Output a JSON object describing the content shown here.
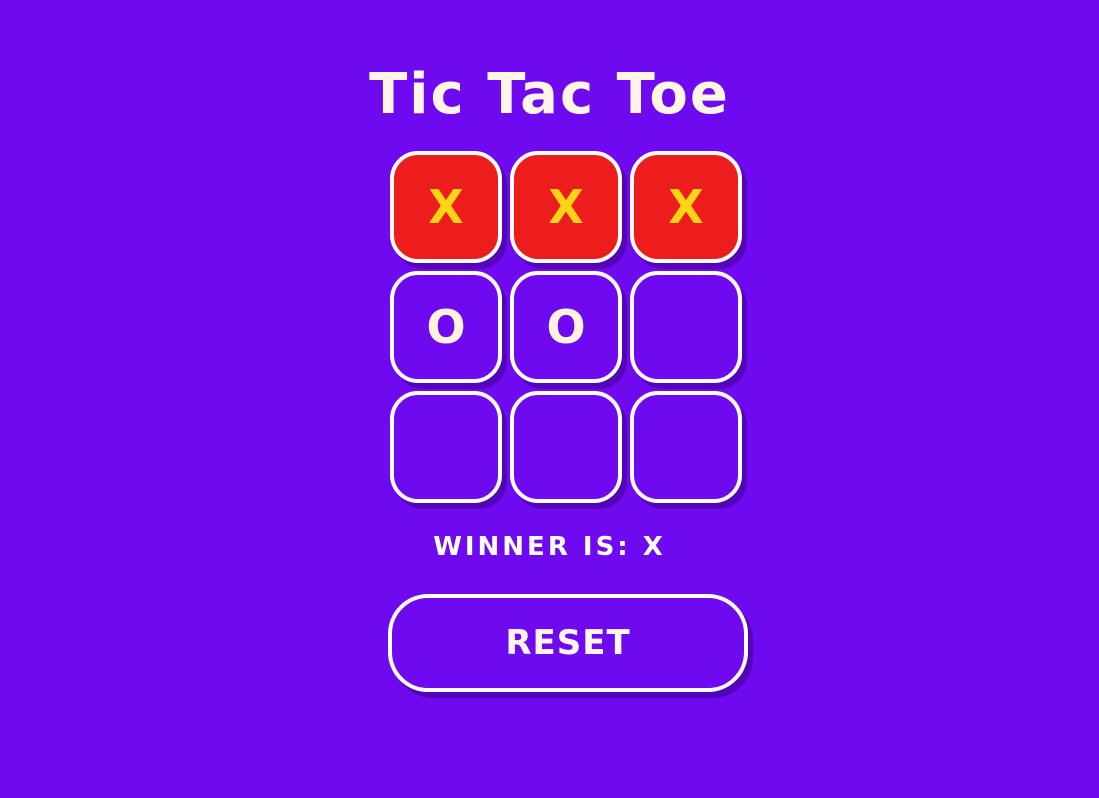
{
  "title": "Tic Tac Toe",
  "board": {
    "cells": [
      {
        "mark": "X",
        "winning": true
      },
      {
        "mark": "X",
        "winning": true
      },
      {
        "mark": "X",
        "winning": true
      },
      {
        "mark": "O",
        "winning": false
      },
      {
        "mark": "O",
        "winning": false
      },
      {
        "mark": "",
        "winning": false
      },
      {
        "mark": "",
        "winning": false
      },
      {
        "mark": "",
        "winning": false
      },
      {
        "mark": "",
        "winning": false
      }
    ]
  },
  "status": "WINNER IS: X",
  "reset_label": "RESET",
  "colors": {
    "background": "#6f0af0",
    "win_cell": "#ee1d1d",
    "x_mark": "#ffd316",
    "o_mark": "#fff3de",
    "border": "#ffffff"
  }
}
